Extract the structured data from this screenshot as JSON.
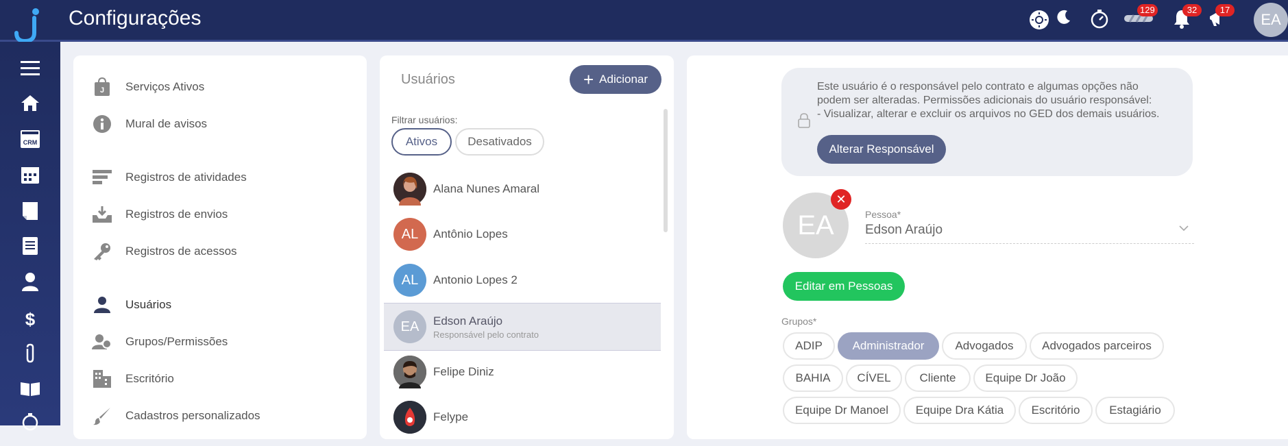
{
  "app": {
    "title": "Configurações",
    "logo_glyph": "j"
  },
  "topbar": {
    "badges": {
      "tasks": "129",
      "notifications": "32",
      "announcements": "17"
    },
    "avatar_initials": "EA"
  },
  "sidebar_menu": {
    "items": [
      {
        "label": "Serviços Ativos",
        "icon": "shopping-bag-icon"
      },
      {
        "label": "Mural de avisos",
        "icon": "info-icon"
      },
      {
        "label": "Registros de atividades",
        "icon": "list-icon"
      },
      {
        "label": "Registros de envios",
        "icon": "inbox-icon"
      },
      {
        "label": "Registros de acessos",
        "icon": "key-icon"
      },
      {
        "label": "Usuários",
        "icon": "user-icon"
      },
      {
        "label": "Grupos/Permissões",
        "icon": "user-group-icon"
      },
      {
        "label": "Escritório",
        "icon": "building-icon"
      },
      {
        "label": "Cadastros personalizados",
        "icon": "brush-icon"
      }
    ]
  },
  "users_panel": {
    "title": "Usuários",
    "add_label": "Adicionar",
    "filter_label": "Filtrar usuários:",
    "filters": [
      "Ativos",
      "Desativados"
    ],
    "users": [
      {
        "name": "Alana Nunes Amaral",
        "initials": "",
        "subtitle": ""
      },
      {
        "name": "Antônio Lopes",
        "initials": "AL",
        "subtitle": ""
      },
      {
        "name": "Antonio Lopes 2",
        "initials": "AL",
        "subtitle": ""
      },
      {
        "name": "Edson Araújo",
        "initials": "EA",
        "subtitle": "Responsável pelo contrato"
      },
      {
        "name": "Felipe Diniz",
        "initials": "",
        "subtitle": ""
      },
      {
        "name": "Felype",
        "initials": "",
        "subtitle": ""
      }
    ]
  },
  "detail": {
    "notice_line1": "Este usuário é o responsável pelo contrato e algumas opções não",
    "notice_line2": "podem ser alteradas. Permissões adicionais do usuário responsável:",
    "notice_line3": "- Visualizar, alterar e excluir os arquivos no GED dos demais usuários.",
    "alter_label": "Alterar Responsável",
    "avatar_initials": "EA",
    "pessoa_label": "Pessoa*",
    "pessoa_value": "Edson Araújo",
    "edit_label": "Editar em Pessoas",
    "groups_label": "Grupos*",
    "groups": [
      "ADIP",
      "Administrador",
      "Advogados",
      "Advogados parceiros",
      "BAHIA",
      "CÍVEL",
      "Cliente",
      "Equipe Dr João",
      "Equipe Dr Manoel",
      "Equipe Dra Kátia",
      "Escritório",
      "Estagiário"
    ]
  },
  "colors": {
    "topbar": "#1f2c5e",
    "accent": "#566188",
    "success": "#22c55e",
    "badge": "#e02424",
    "selected_chip": "#9ba3c2"
  }
}
